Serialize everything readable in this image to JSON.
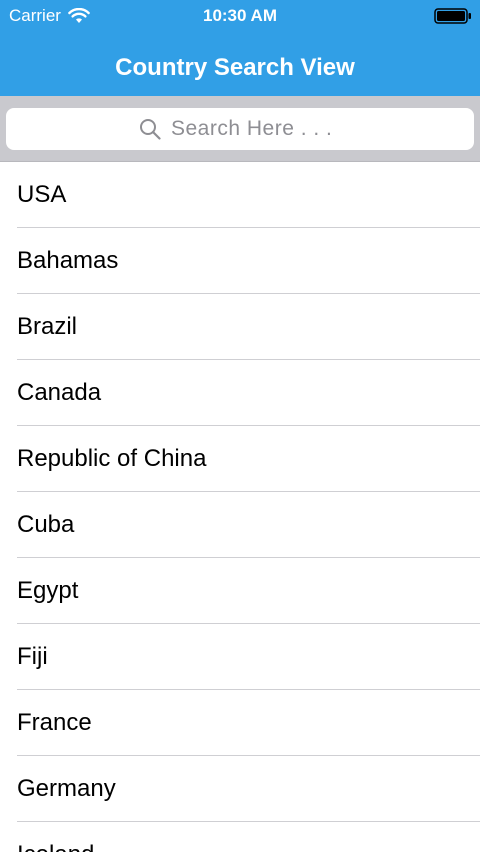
{
  "status_bar": {
    "carrier": "Carrier",
    "time": "10:30 AM",
    "wifi_icon": "wifi-icon",
    "battery_icon": "battery-icon"
  },
  "nav": {
    "title": "Country Search View",
    "background_color": "#319fe6"
  },
  "search": {
    "placeholder": "Search Here . . .",
    "value": "",
    "icon": "search-icon"
  },
  "countries": [
    "USA",
    "Bahamas",
    "Brazil",
    "Canada",
    "Republic of China",
    "Cuba",
    "Egypt",
    "Fiji",
    "France",
    "Germany",
    "Iceland"
  ]
}
